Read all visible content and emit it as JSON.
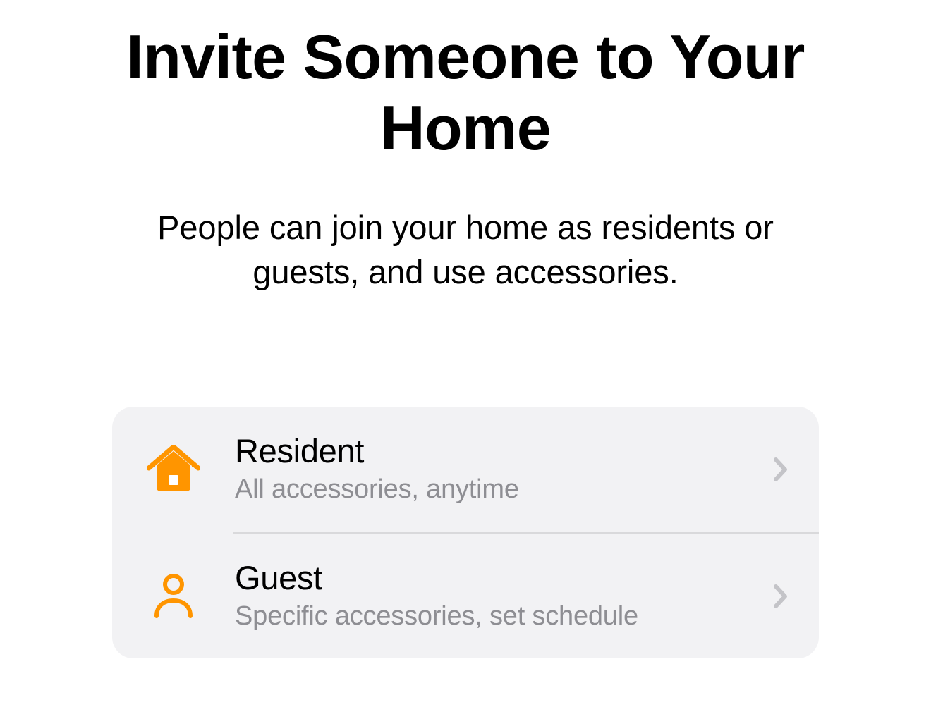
{
  "header": {
    "title": "Invite Someone to Your Home",
    "subtitle": "People can join your home as residents or guests, and use accessories."
  },
  "options": [
    {
      "icon": "house-icon",
      "title": "Resident",
      "description": "All accessories, anytime"
    },
    {
      "icon": "person-icon",
      "title": "Guest",
      "description": "Specific accessories, set schedule"
    }
  ],
  "colors": {
    "accent": "#ff9500",
    "chevron": "#c7c7cc"
  }
}
